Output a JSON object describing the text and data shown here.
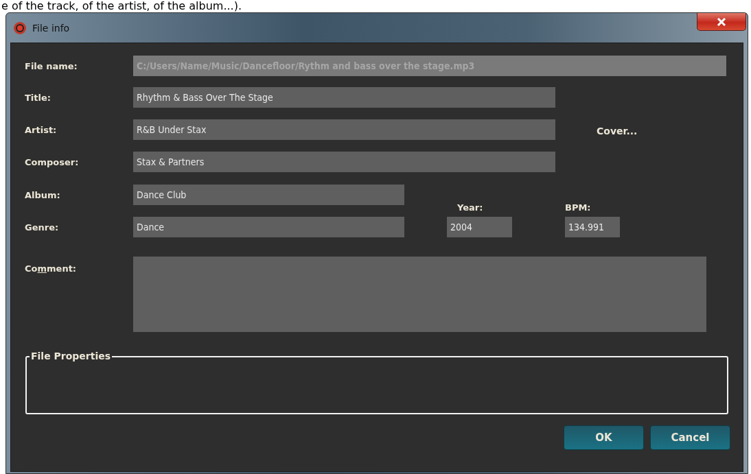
{
  "caption": "e of the track, of the artist, of the album...).",
  "window": {
    "title": "File info"
  },
  "file_name": {
    "label": "File name:",
    "value": "C:/Users/Name/Music/Dancefloor/Rythm and bass over the stage.mp3",
    "disabled": true
  },
  "title": {
    "label": "Title:",
    "value": "Rhythm & Bass Over The Stage",
    "disabled": false
  },
  "artist": {
    "label": "Artist:",
    "value": "R&B Under Stax",
    "disabled": false
  },
  "composer": {
    "label": "Composer:",
    "value": "Stax & Partners",
    "disabled": false
  },
  "cover_button": "Cover...",
  "album": {
    "label": "Album:",
    "value": "Dance Club",
    "disabled": false
  },
  "genre": {
    "label": "Genre:",
    "value": "Dance",
    "disabled": false
  },
  "year": {
    "label": "Year:",
    "value": "2004",
    "disabled": false
  },
  "bpm": {
    "label": "BPM:",
    "value": "134.991",
    "disabled": false
  },
  "comment": {
    "label_before": "Co",
    "label_key": "m",
    "label_after": "ment:",
    "disabled": false
  },
  "file_properties": {
    "title": "File Properties"
  },
  "buttons": [
    "OK",
    "Cancel"
  ]
}
